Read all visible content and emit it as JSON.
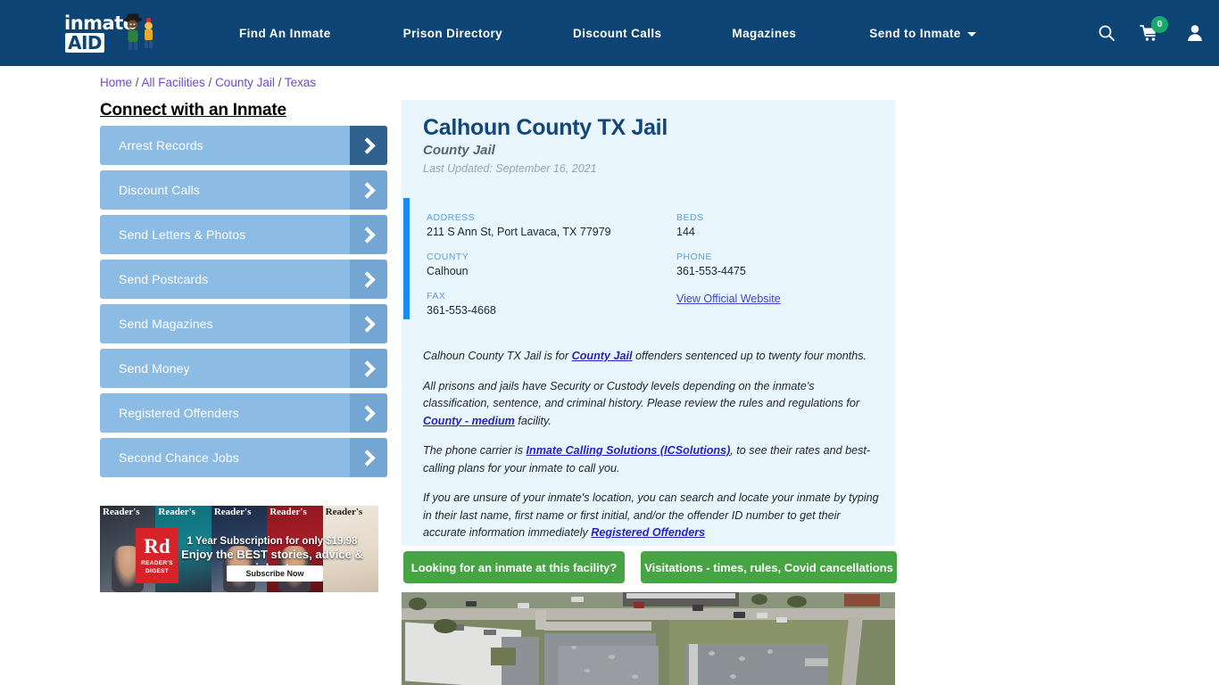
{
  "nav": {
    "logo_text": "inmate",
    "logo_badge": "AID",
    "links": [
      {
        "label": "Find An Inmate"
      },
      {
        "label": "Prison Directory"
      },
      {
        "label": "Discount Calls"
      },
      {
        "label": "Magazines"
      },
      {
        "label": "Send to Inmate"
      }
    ],
    "cart_count": "0",
    "accent_color": "#0c4475",
    "cart_badge_color": "#18a96b"
  },
  "breadcrumb": {
    "items": [
      "Home",
      "All Facilities",
      "County Jail",
      "Texas"
    ],
    "separator": "/"
  },
  "sidebar": {
    "title": "Connect with an Inmate",
    "items": [
      {
        "label": "Arrest Records"
      },
      {
        "label": "Discount Calls"
      },
      {
        "label": "Send Letters & Photos"
      },
      {
        "label": "Send Postcards"
      },
      {
        "label": "Send Magazines"
      },
      {
        "label": "Send Money"
      },
      {
        "label": "Registered Offenders"
      },
      {
        "label": "Second Chance Jobs"
      }
    ]
  },
  "ad": {
    "covers": [
      "Reader's",
      "Reader's",
      "Reader's",
      "Reader's",
      "Reader's"
    ],
    "cover_sub": "digest",
    "logo_line1": "Rd",
    "logo_line2": "READER'S DIGEST",
    "headline1": "1 Year Subscription for only $19.98",
    "headline2": "Enjoy the BEST stories, advice & jokes!",
    "cta": "Subscribe Now"
  },
  "facility": {
    "title": "Calhoun County TX Jail",
    "type": "County Jail",
    "last_updated": "Last Updated: September 16, 2021",
    "info_left": [
      {
        "label": "ADDRESS",
        "value": "211 S Ann St, Port Lavaca, TX 77979"
      },
      {
        "label": "COUNTY",
        "value": "Calhoun"
      },
      {
        "label": "FAX",
        "value": "361-553-4668"
      }
    ],
    "info_right": [
      {
        "label": "BEDS",
        "value": "144"
      },
      {
        "label": "PHONE",
        "value": "361-553-4475"
      }
    ],
    "official_website_link": "View Official Website"
  },
  "body": {
    "p1_a": "Calhoun County TX Jail is for ",
    "p1_link": "County Jail",
    "p1_b": " offenders sentenced up to twenty four months.",
    "p2_a": "All prisons and jails have Security or Custody levels depending on the inmate's classification, sentence, and criminal history. Please review the rules and regulations for ",
    "p2_link": "County - medium",
    "p2_b": " facility.",
    "p3_a": "The phone carrier is ",
    "p3_link": "Inmate Calling Solutions (ICSolutions)",
    "p3_b": ", to see their rates and best-calling plans for your inmate to call you.",
    "p4_a": "If you are unsure of your inmate's location, you can search and locate your inmate by typing in their last name, first name or first initial, and/or the offender ID number to get their accurate information immediately ",
    "p4_link": "Registered Offenders"
  },
  "buttons": {
    "find_inmate": "Looking for an inmate at this facility?",
    "visitations": "Visitations - times, rules, Covid cancellations",
    "color": "#46a444"
  },
  "aerial": {
    "alt": "Aerial satellite view of Calhoun County TX Jail"
  }
}
